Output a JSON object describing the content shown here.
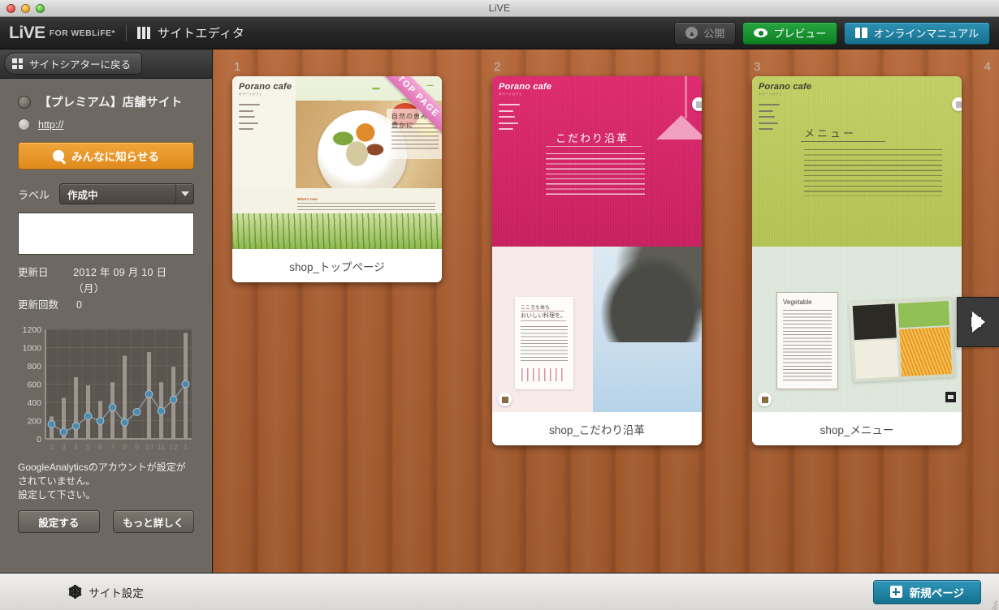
{
  "window": {
    "title": "LiVE"
  },
  "toolbar": {
    "brand_live": "LiVE",
    "brand_for": "FOR WEBLiFE*",
    "brand_title": "サイトエディタ",
    "publish_label": "公開",
    "preview_label": "プレビュー",
    "manual_label": "オンラインマニュアル"
  },
  "sidebar": {
    "back_label": "サイトシアターに戻る",
    "site_name": "【プレミアム】店舗サイト",
    "url": "http://",
    "notify_label": "みんなに知らせる",
    "label_caption": "ラベル",
    "label_value": "作成中",
    "label_options": [
      "作成中"
    ],
    "memo_value": "",
    "updated_key": "更新日",
    "updated_value": "2012 年 09 月 10 日 （月）",
    "count_key": "更新回数",
    "count_value": "0",
    "ga_note": "GoogleAnalyticsのアカウントが設定が\nされていません。\n設定して下さい。",
    "ga_setup_label": "設定する",
    "ga_more_label": "もっと詳しく",
    "site_settings_label": "サイト設定"
  },
  "chart_data": {
    "type": "bar",
    "title": "",
    "xlabel": "",
    "ylabel": "",
    "categories": [
      "2",
      "3",
      "4",
      "5",
      "6",
      "7",
      "8",
      "9",
      "10",
      "11",
      "12",
      "1"
    ],
    "yticks": [
      0,
      200,
      400,
      600,
      800,
      1000,
      1200
    ],
    "ylim": [
      0,
      1200
    ],
    "grid": true,
    "legend": "none",
    "series": [
      {
        "name": "bars",
        "type": "bar",
        "color": "#9b958e",
        "values": [
          245,
          450,
          675,
          585,
          415,
          620,
          910,
          0,
          950,
          620,
          790,
          1160
        ]
      },
      {
        "name": "line",
        "type": "line",
        "color": "#4a8cae",
        "values": [
          160,
          75,
          140,
          250,
          195,
          345,
          180,
          295,
          490,
          305,
          430,
          600
        ]
      }
    ]
  },
  "canvas": {
    "pages": [
      {
        "number": "1",
        "caption": "shop_トップページ",
        "ribbon": "TOP PAGE",
        "logo": "Porano cafe",
        "logo_sub": "ポラーノカフェ",
        "nav": [
          "こだわり沿革",
          "メニュー",
          "サービス",
          "スケジュール",
          "アクセス"
        ],
        "headline": "自然の恵み、　豊かに",
        "news_label": "What's new"
      },
      {
        "number": "2",
        "caption": "shop_こだわり沿革",
        "ribbon": "",
        "logo": "Porano cafe",
        "logo_sub": "ポラーノカフェ",
        "nav": [
          "こだわり沿革",
          "メニュー",
          "サービス",
          "スケジュール",
          "アクセス"
        ],
        "headline": "こだわり沿革",
        "card_line1": "こころも体も",
        "card_line2": "おいしい料理を。"
      },
      {
        "number": "3",
        "caption": "shop_メニュー",
        "ribbon": "",
        "logo": "Porano cafe",
        "logo_sub": "ポラーノカフェ",
        "nav": [
          "こだわり沿革",
          "メニュー",
          "サービス",
          "スケジュール",
          "アクセス"
        ],
        "headline": "メニュー",
        "card_line1": "Vegetable"
      }
    ],
    "next_slot_number": "4"
  },
  "bottom": {
    "new_page_label": "新規ページ"
  },
  "colors": {
    "accent_orange": "#e08b1c",
    "accent_teal": "#16718f",
    "accent_green": "#0e7f23",
    "wood": "#a65c30",
    "sidebar": "#6e6862",
    "chart_bar": "#9b958e",
    "chart_line": "#4a8cae"
  }
}
